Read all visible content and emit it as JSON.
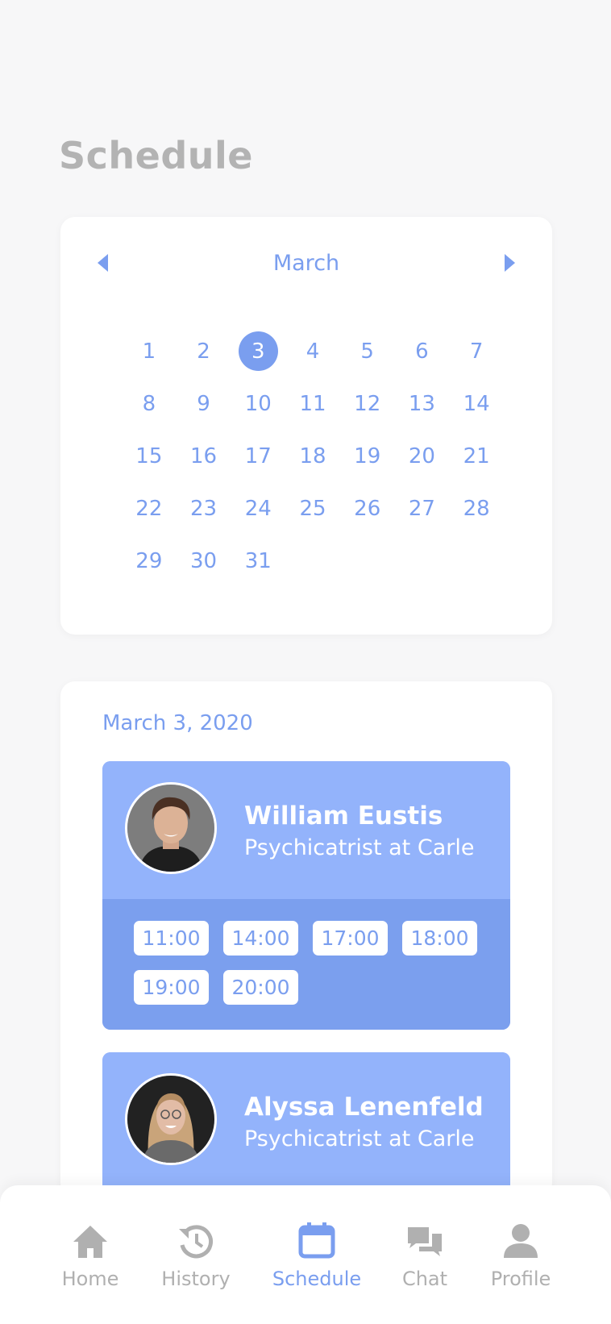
{
  "page": {
    "title": "Schedule"
  },
  "calendar": {
    "month": "March",
    "selected_day": "3",
    "days": [
      "1",
      "2",
      "3",
      "4",
      "5",
      "6",
      "7",
      "8",
      "9",
      "10",
      "11",
      "12",
      "13",
      "14",
      "15",
      "16",
      "17",
      "18",
      "19",
      "20",
      "21",
      "22",
      "23",
      "24",
      "25",
      "26",
      "27",
      "28",
      "29",
      "30",
      "31"
    ],
    "prev_icon": "caret-left-icon",
    "next_icon": "caret-right-icon"
  },
  "appointments": {
    "date": "March 3, 2020",
    "doctors": [
      {
        "name": "William Eustis",
        "role": "Psychicatrist at Carle",
        "slots": [
          "11:00",
          "14:00",
          "17:00",
          "18:00",
          "19:00",
          "20:00"
        ]
      },
      {
        "name": "Alyssa Lenenfeld",
        "role": "Psychicatrist at Carle"
      }
    ]
  },
  "nav": {
    "items": [
      {
        "label": "Home",
        "icon": "home-icon"
      },
      {
        "label": "History",
        "icon": "history-icon"
      },
      {
        "label": "Schedule",
        "icon": "calendar-icon",
        "active": true
      },
      {
        "label": "Chat",
        "icon": "chat-icon"
      },
      {
        "label": "Profile",
        "icon": "person-icon"
      }
    ]
  },
  "colors": {
    "accent": "#7a9eef",
    "card_light": "#93b3fb",
    "card_dark": "#7b9fee",
    "muted": "#b0b0b0"
  }
}
